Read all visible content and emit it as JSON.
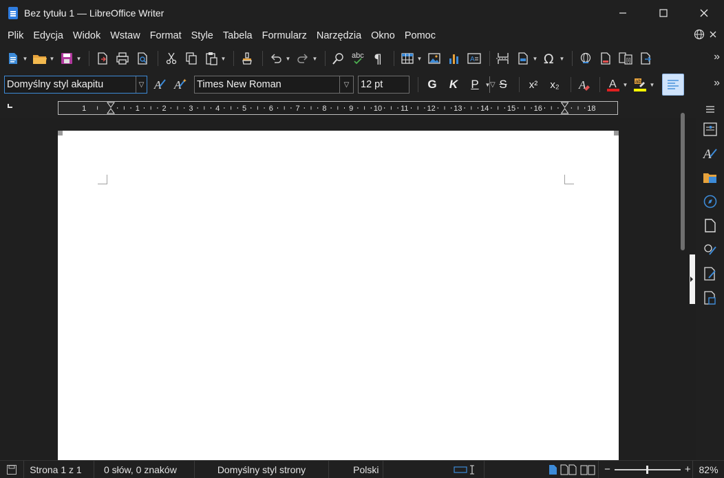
{
  "window": {
    "title": "Bez tytułu 1 — LibreOffice Writer",
    "minimize": "—",
    "maximize": "☐",
    "close": "✕"
  },
  "menu": [
    "Plik",
    "Edycja",
    "Widok",
    "Wstaw",
    "Format",
    "Style",
    "Tabela",
    "Formularz",
    "Narzędzia",
    "Okno",
    "Pomoc"
  ],
  "formatting": {
    "paragraph_style": "Domyślny styl akapitu",
    "font_name": "Times New Roman",
    "font_size": "12 pt",
    "bold_label": "G",
    "italic_label": "K",
    "underline_label": "P",
    "strike_label": "S",
    "superscript_label": "x²",
    "subscript_label": "x₂"
  },
  "ruler": {
    "left_labels": [
      "1"
    ],
    "labels": [
      "1",
      "2",
      "3",
      "4",
      "5",
      "6",
      "7",
      "8",
      "9",
      "10",
      "11",
      "12",
      "13",
      "14",
      "15",
      "16",
      "18"
    ]
  },
  "status": {
    "page": "Strona 1 z 1",
    "words": "0 słów, 0 znaków",
    "page_style": "Domyślny styl strony",
    "language": "Polski",
    "zoom": "82%",
    "zoom_level": 0.5
  },
  "colors": {
    "accent": "#3d8bd8",
    "font_color_bar": "#e02020",
    "highlight_bar": "#ffff00"
  }
}
